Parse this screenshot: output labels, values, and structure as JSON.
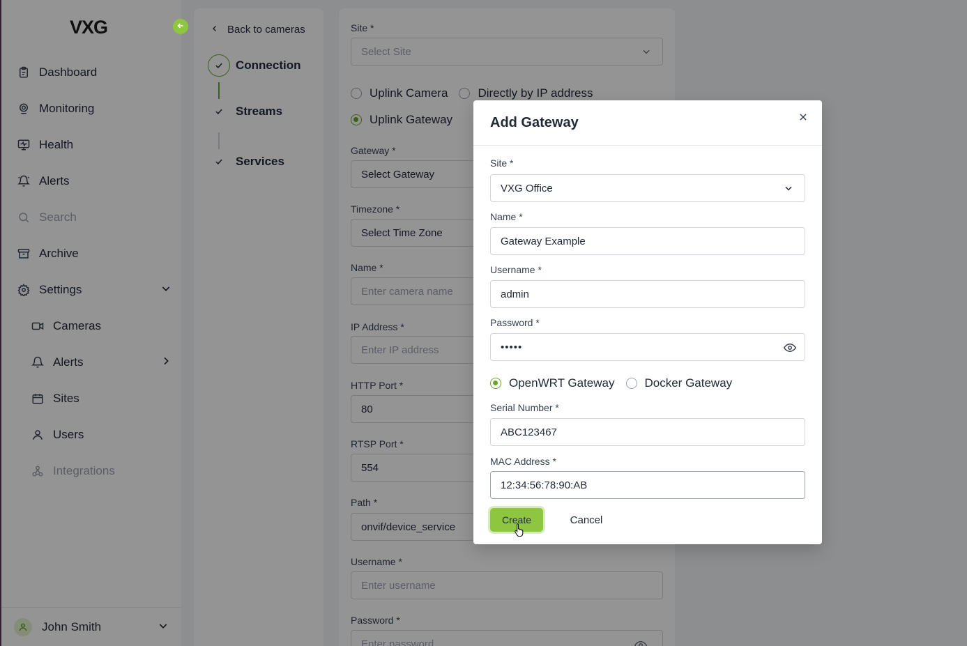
{
  "sidebar": {
    "logo": "VXG",
    "items": [
      {
        "label": "Dashboard"
      },
      {
        "label": "Monitoring"
      },
      {
        "label": "Health"
      },
      {
        "label": "Alerts"
      },
      {
        "label": "Search"
      },
      {
        "label": "Archive"
      },
      {
        "label": "Settings"
      }
    ],
    "sub_items": [
      {
        "label": "Cameras"
      },
      {
        "label": "Alerts"
      },
      {
        "label": "Sites"
      },
      {
        "label": "Users"
      },
      {
        "label": "Integrations"
      }
    ],
    "user": "John Smith"
  },
  "steps": {
    "back": "Back to cameras",
    "items": [
      {
        "label": "Connection"
      },
      {
        "label": "Streams"
      },
      {
        "label": "Services"
      }
    ]
  },
  "form": {
    "site_label": "Site *",
    "site_placeholder": "Select Site",
    "radio_uplink_camera": "Uplink Camera",
    "radio_direct_ip": "Directly by IP address",
    "radio_uplink_gateway": "Uplink Gateway",
    "gateway_label": "Gateway *",
    "gateway_placeholder": "Select Gateway",
    "timezone_label": "Timezone *",
    "timezone_placeholder": "Select Time Zone",
    "name_label": "Name *",
    "name_placeholder": "Enter camera name",
    "ip_label": "IP Address *",
    "ip_placeholder": "Enter IP address",
    "http_label": "HTTP Port *",
    "http_value": "80",
    "rtsp_label": "RTSP Port *",
    "rtsp_value": "554",
    "path_label": "Path *",
    "path_value": "onvif/device_service",
    "username_label": "Username *",
    "username_placeholder": "Enter username",
    "password_label": "Password *",
    "password_placeholder": "Enter password"
  },
  "modal": {
    "title": "Add Gateway",
    "site_label": "Site *",
    "site_value": "VXG Office",
    "name_label": "Name *",
    "name_value": "Gateway Example",
    "username_label": "Username *",
    "username_value": "admin",
    "password_label": "Password *",
    "password_value": "•••••",
    "radio_openwrt": "OpenWRT Gateway",
    "radio_docker": "Docker Gateway",
    "serial_label": "Serial Number *",
    "serial_value": "ABC123467",
    "mac_label": "MAC Address *",
    "mac_value": "12:34:56:78:90:AB",
    "create_label": "Create",
    "cancel_label": "Cancel"
  },
  "colors": {
    "accent": "#8fc63f",
    "accent_dark": "#6aa52a"
  }
}
